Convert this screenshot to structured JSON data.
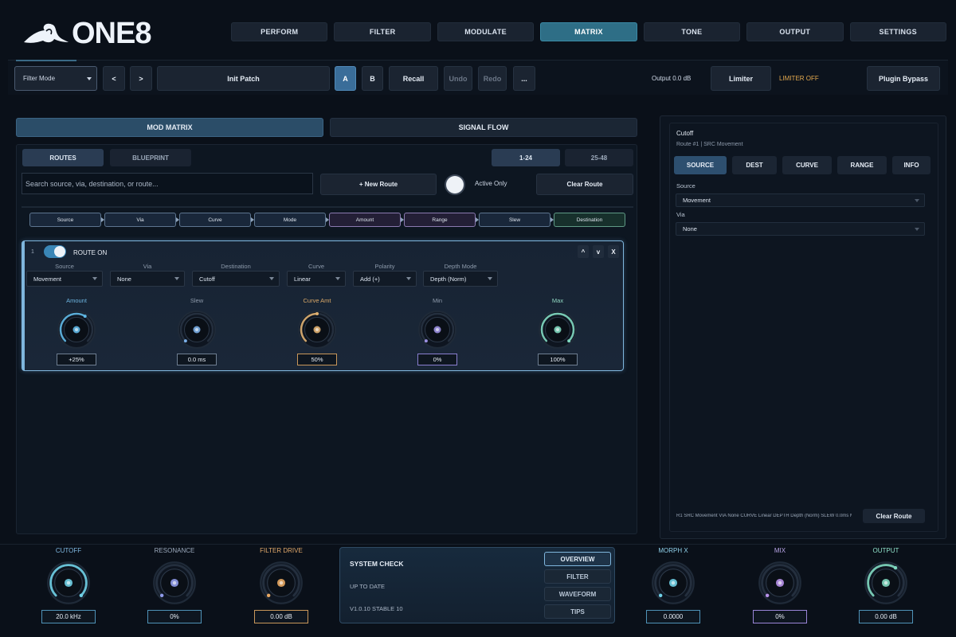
{
  "brand": {
    "name": "ONE8"
  },
  "nav": {
    "tabs": [
      {
        "label": "PERFORM",
        "active": false
      },
      {
        "label": "FILTER",
        "active": false
      },
      {
        "label": "MODULATE",
        "active": false
      },
      {
        "label": "MATRIX",
        "active": true
      },
      {
        "label": "TONE",
        "active": false
      },
      {
        "label": "OUTPUT",
        "active": false
      },
      {
        "label": "SETTINGS",
        "active": false
      }
    ]
  },
  "toolbar": {
    "mode_select": "Filter Mode",
    "prev_label": "<",
    "next_label": ">",
    "patch_name": "Init Patch",
    "a_label": "A",
    "b_label": "B",
    "recall_label": "Recall",
    "undo_label": "Undo",
    "redo_label": "Redo",
    "more_label": "...",
    "output_text": "Output 0.0 dB",
    "limiter_label": "Limiter",
    "limiter_status": "LIMITER OFF",
    "bypass_label": "Plugin Bypass"
  },
  "matrix": {
    "tabs": {
      "mod_matrix": "MOD MATRIX",
      "signal_flow": "SIGNAL FLOW"
    },
    "subtabs": {
      "routes": "ROUTES",
      "blueprint": "BLUEPRINT"
    },
    "pages": {
      "page1": "1-24",
      "page2": "25-48"
    },
    "search_placeholder": "Search source, via, destination, or route...",
    "new_route_label": "+ New Route",
    "active_only_label": "Active Only",
    "clear_route_label": "Clear Route",
    "chain": [
      "Source",
      "Via",
      "Curve",
      "Mode",
      "Amount",
      "Range",
      "Slew",
      "Destination"
    ]
  },
  "route": {
    "number": "1",
    "status": "ROUTE ON",
    "up_label": "^",
    "down_label": "v",
    "close_label": "X",
    "fields": {
      "source": {
        "label": "Source",
        "value": "Movement"
      },
      "via": {
        "label": "Via",
        "value": "None"
      },
      "destination": {
        "label": "Destination",
        "value": "Cutoff"
      },
      "curve": {
        "label": "Curve",
        "value": "Linear"
      },
      "polarity": {
        "label": "Polarity",
        "value": "Add (+)"
      },
      "depth_mode": {
        "label": "Depth Mode",
        "value": "Depth (Norm)"
      }
    },
    "knobs": {
      "amount": {
        "label": "Amount",
        "value": "+25%",
        "level": 0.62,
        "color": "#5fb8e6"
      },
      "slew": {
        "label": "Slew",
        "value": "0.0 ms",
        "level": 0.0,
        "color": "#7aaee6"
      },
      "curve_amt": {
        "label": "Curve Amt",
        "value": "50%",
        "level": 0.5,
        "color": "#e0b070"
      },
      "min": {
        "label": "Min",
        "value": "0%",
        "level": 0.0,
        "color": "#9a8fe0"
      },
      "max": {
        "label": "Max",
        "value": "100%",
        "level": 1.0,
        "color": "#7fd8bf"
      }
    }
  },
  "inspector": {
    "title": "Cutoff",
    "subtitle": "Route #1  |  SRC Movement",
    "tabs": [
      "SOURCE",
      "DEST",
      "CURVE",
      "RANGE",
      "INFO"
    ],
    "source_label": "Source",
    "source_value": "Movement",
    "via_label": "Via",
    "via_value": "None",
    "summary": "R1  SRC Movement  VIA None  CURVE Linear  DEPTH Depth (Norm)  SLEW 0.0ms  MI...",
    "clear_label": "Clear Route"
  },
  "bottom": {
    "cutoff": {
      "label": "CUTOFF",
      "value": "20.0 kHz",
      "level": 1.0,
      "color": "#6fd0e6",
      "label_color": "#7fb8e0"
    },
    "resonance": {
      "label": "RESONANCE",
      "value": "0%",
      "level": 0.0,
      "color": "#8f9bea",
      "label_color": "#9aa8bb"
    },
    "filter_drive": {
      "label": "FILTER DRIVE",
      "value": "0.00 dB",
      "level": 0.0,
      "color": "#e8a862",
      "label_color": "#e0a86a"
    },
    "morph_x": {
      "label": "MORPH X",
      "value": "0.0000",
      "level": 0.0,
      "color": "#6fd0e6",
      "label_color": "#8fcfe8"
    },
    "mix": {
      "label": "MIX",
      "value": "0%",
      "level": 0.0,
      "color": "#b892ea",
      "label_color": "#b8a4e6"
    },
    "output": {
      "label": "OUTPUT",
      "value": "0.00 dB",
      "level": 0.62,
      "color": "#7fd8bf",
      "label_color": "#8fe0c8"
    }
  },
  "system_check": {
    "title": "SYSTEM CHECK",
    "status": "UP TO DATE",
    "version": "V1.0.10 STABLE 10",
    "buttons": [
      "OVERVIEW",
      "FILTER",
      "WAVEFORM",
      "TIPS"
    ]
  }
}
